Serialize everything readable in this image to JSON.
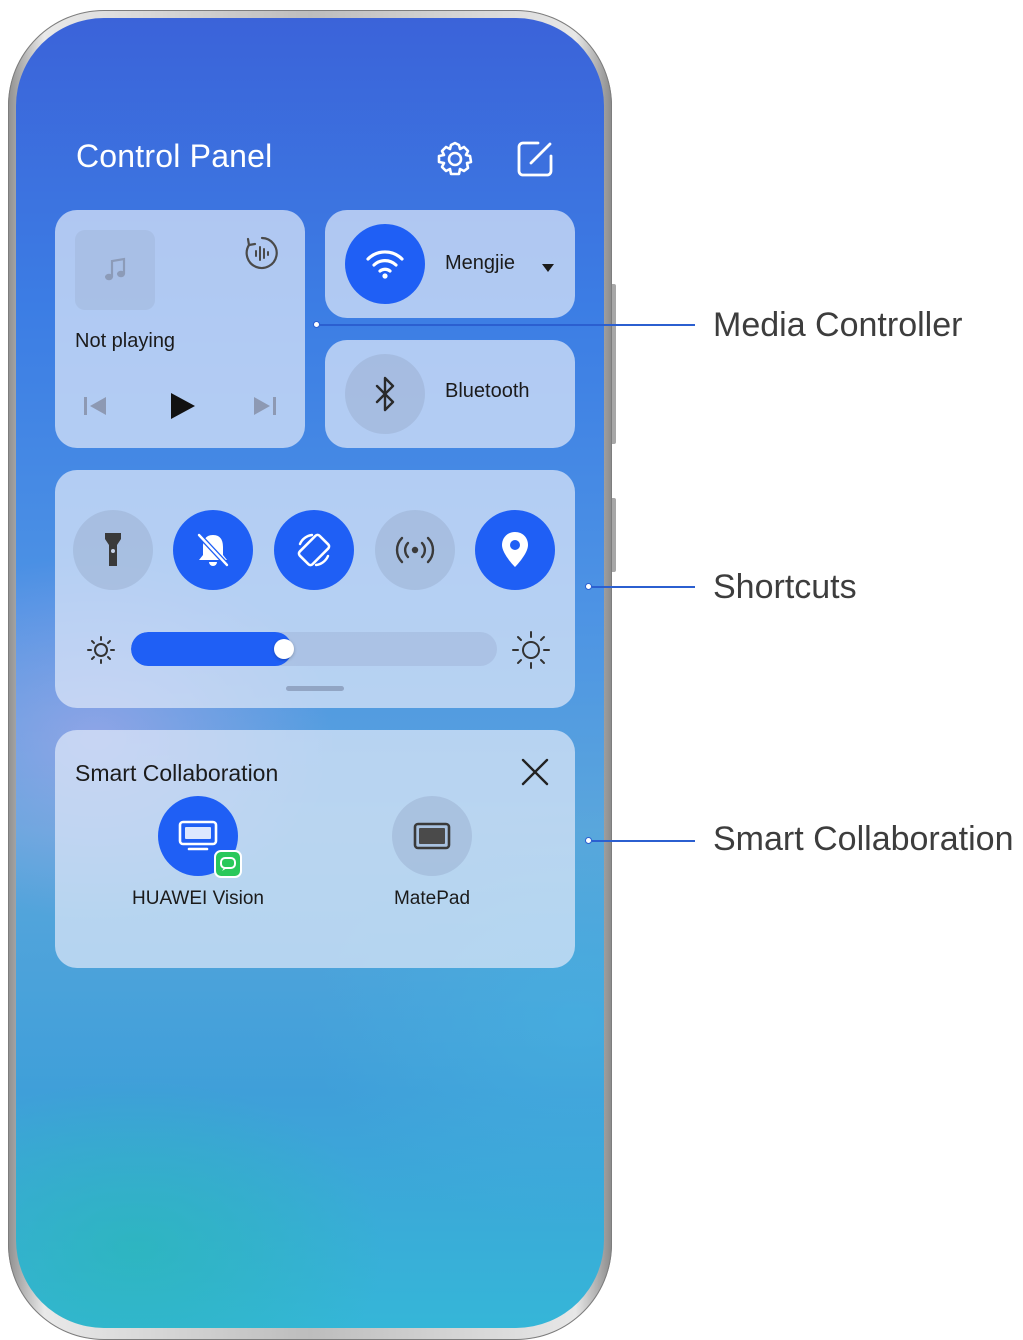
{
  "control_panel": {
    "title": "Control Panel",
    "header_icons": [
      "gear-icon",
      "edit-icon"
    ]
  },
  "media": {
    "status": "Not playing",
    "icons": [
      "music-note-icon",
      "audio-output-icon",
      "previous-track-icon",
      "play-icon",
      "next-track-icon"
    ]
  },
  "wifi": {
    "label": "Mengjie",
    "state": "on",
    "icon": "wifi-icon"
  },
  "bluetooth": {
    "label": "Bluetooth",
    "state": "off",
    "icon": "bluetooth-icon"
  },
  "shortcuts": {
    "toggles": [
      {
        "name": "flashlight",
        "icon": "flashlight-icon",
        "state": "off"
      },
      {
        "name": "silent-mode",
        "icon": "bell-off-icon",
        "state": "on"
      },
      {
        "name": "auto-rotate",
        "icon": "rotate-icon",
        "state": "on"
      },
      {
        "name": "hotspot",
        "icon": "hotspot-icon",
        "state": "off"
      },
      {
        "name": "location",
        "icon": "location-pin-icon",
        "state": "on"
      }
    ],
    "brightness": 0.44
  },
  "smart_collaboration": {
    "title": "Smart Collaboration",
    "devices": [
      {
        "name": "HUAWEI Vision",
        "icon": "tv-icon",
        "state": "on"
      },
      {
        "name": "MatePad",
        "icon": "tablet-icon",
        "state": "off"
      }
    ]
  },
  "callouts": [
    {
      "label": "Media Controller"
    },
    {
      "label": "Shortcuts"
    },
    {
      "label": "Smart Collaboration"
    }
  ],
  "colors": {
    "accent": "#1f5ff5",
    "callout_line": "#2b5fd0",
    "callout_text": "#3d3d3d"
  }
}
